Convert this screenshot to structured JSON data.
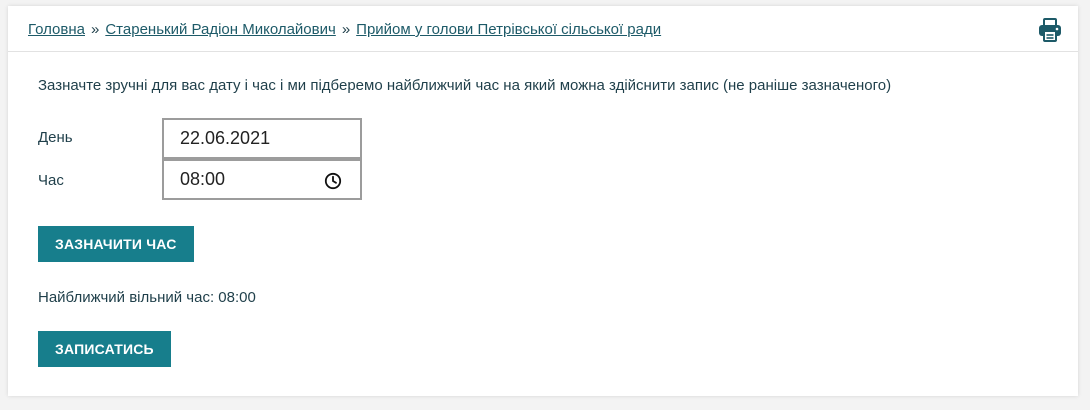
{
  "breadcrumb": {
    "items": [
      "Головна",
      "Старенький Радіон Миколайович",
      "Прийом у голови Петрівської сільської ради"
    ],
    "separator": "»"
  },
  "icons": {
    "print": "printer-icon",
    "clock": "clock-icon"
  },
  "form": {
    "intro": "Зазначте зручні для вас дату і час і ми підберемо найближчий час на який можна здійснити запис (не раніше зазначеного)",
    "day_label": "День",
    "day_value": "22.06.2021",
    "time_label": "Час",
    "time_value": "08:00",
    "mark_button": "ЗАЗНАЧИТИ ЧАС",
    "nearest_text": "Найближчий вільний час: 08:00",
    "signup_button": "ЗАПИСАТИСЬ"
  },
  "colors": {
    "accent": "#177e8c",
    "link": "#1d5a68",
    "text": "#1f3f4a"
  }
}
